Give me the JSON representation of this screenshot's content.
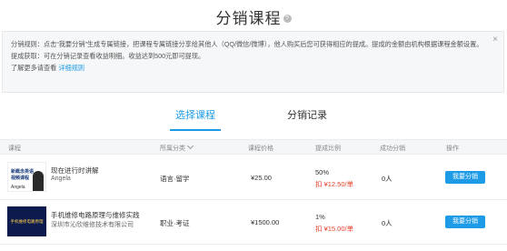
{
  "page": {
    "title": "分销课程",
    "help_glyph": "?"
  },
  "notice": {
    "line1": "分销规则：点击“我要分销”生成专属链接，把课程专属链接分享给其他人（QQ/微信/微博），他人购买后您可获得相应的提成。提成的金额由机构根据课程金额设置。",
    "line2": "提成获取：可在分销记录查看收益明细。收益达到500元即可提现。",
    "line3_prefix": "了解更多请查看",
    "line3_link": "详细规则",
    "close_glyph": "×"
  },
  "tabs": [
    {
      "label": "选择课程",
      "active": true
    },
    {
      "label": "分销记录",
      "active": false
    }
  ],
  "table": {
    "headers": {
      "course": "课程",
      "category": "所属分类",
      "price": "课程价格",
      "ratio": "提成比例",
      "success": "成功分销",
      "action": "操作"
    },
    "rows": [
      {
        "thumb_text_1": "新概念英语",
        "thumb_text_2": "视频课程",
        "thumb_text_3": "Angela",
        "title": "现在进行时讲解",
        "subtitle": "Angela",
        "category": "语言·留学",
        "price": "¥25.00",
        "ratio": "50%",
        "commission": "扣 ¥12.50/单",
        "success": "0人",
        "button": "我要分销"
      },
      {
        "thumb_text_1": "手机维修电路原理",
        "thumb_text_2": "",
        "thumb_text_3": "",
        "title": "手机维修电路原理与维修实践",
        "subtitle": "深圳市沁欣维修技术有限公司",
        "category": "职业·考证",
        "price": "¥1500.00",
        "ratio": "1%",
        "commission": "扣 ¥15.00/单",
        "success": "0人",
        "button": "我要分销"
      }
    ]
  },
  "colors": {
    "accent": "#1e9be6",
    "commission": "#e8412c"
  }
}
